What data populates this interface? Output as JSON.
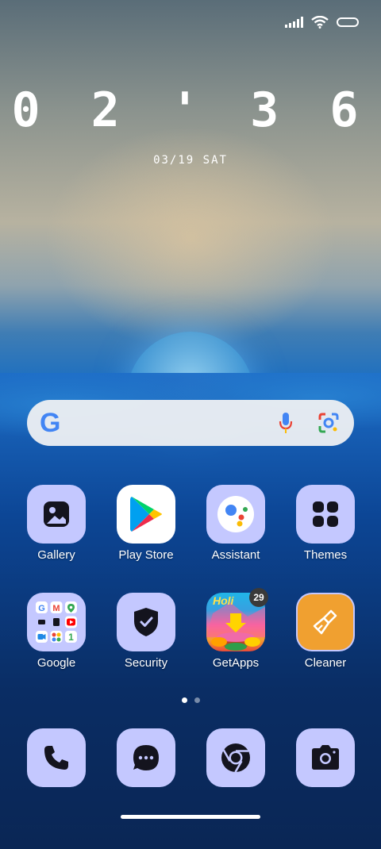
{
  "lockscreen": {
    "time": "0 2 ' 3 6",
    "date": "03/19 SAT"
  },
  "status_bar": {
    "icons": [
      "signal-icon",
      "wifi-icon",
      "battery-icon"
    ]
  },
  "search_bar": {
    "logo": "G",
    "icons": [
      "mic-icon",
      "lens-icon"
    ]
  },
  "apps": [
    {
      "label": "Gallery",
      "icon": "gallery-icon"
    },
    {
      "label": "Play Store",
      "icon": "play-store-icon"
    },
    {
      "label": "Assistant",
      "icon": "assistant-icon"
    },
    {
      "label": "Themes",
      "icon": "themes-icon"
    },
    {
      "label": "Google",
      "icon": "google-folder-icon"
    },
    {
      "label": "Security",
      "icon": "security-icon"
    },
    {
      "label": "GetApps",
      "icon": "getapps-icon",
      "badge": "29",
      "banner": "Holi"
    },
    {
      "label": "Cleaner",
      "icon": "cleaner-icon"
    }
  ],
  "page_indicator": {
    "pages": 2,
    "active": 1
  },
  "dock": [
    {
      "icon": "phone-icon"
    },
    {
      "icon": "messages-icon"
    },
    {
      "icon": "chrome-icon"
    },
    {
      "icon": "camera-icon"
    }
  ],
  "colors": {
    "tile_bg": "#c4c8ff",
    "icon_dark": "#14141e",
    "cleaner_orange": "#f0a030",
    "badge_bg": "#3a3a3a"
  }
}
